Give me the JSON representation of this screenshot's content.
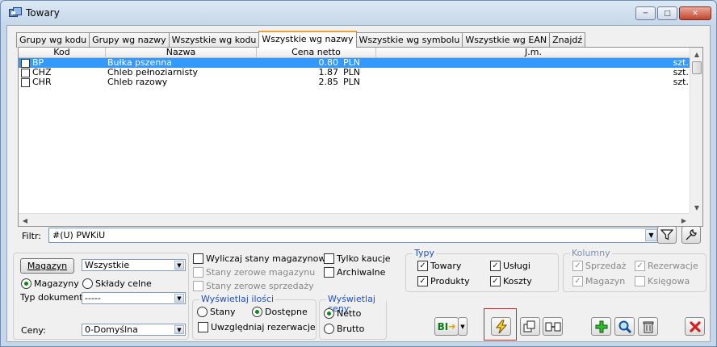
{
  "window": {
    "title": "Towary"
  },
  "tabs": [
    {
      "label": "Grupy wg kodu"
    },
    {
      "label": "Grupy wg nazwy"
    },
    {
      "label": "Wszystkie wg kodu"
    },
    {
      "label": "Wszystkie wg nazwy",
      "active": true
    },
    {
      "label": "Wszystkie wg symbolu"
    },
    {
      "label": "Wszystkie wg EAN"
    },
    {
      "label": "Znajdź"
    }
  ],
  "grid": {
    "columns": [
      "Kod",
      "Nazwa",
      "Cena netto",
      "J.m."
    ],
    "rows": [
      {
        "kod": "BP",
        "nazwa": "Bułka pszenna",
        "cena": "0.80",
        "waluta": "PLN",
        "jm": "szt."
      },
      {
        "kod": "CHZ",
        "nazwa": "Chleb pełnoziarnisty",
        "cena": "1.87",
        "waluta": "PLN",
        "jm": "szt."
      },
      {
        "kod": "CHR",
        "nazwa": "Chleb razowy",
        "cena": "2.85",
        "waluta": "PLN",
        "jm": "szt."
      }
    ]
  },
  "filter": {
    "label": "Filtr:",
    "value": "#(U) PWKiU"
  },
  "left": {
    "magazyn_button": "Magazyn",
    "magazyn_value": "Wszystkie",
    "radio_magazyny": "Magazyny",
    "radio_sklady": "Składy celne",
    "typ_dokumentu_label": "Typ dokumentu:",
    "typ_dokumentu_value": "-----",
    "ceny_label": "Ceny:",
    "ceny_value": "0-Domyślna"
  },
  "stany": {
    "wyliczaj": "Wyliczaj stany magazynowe",
    "zerowe_mag": "Stany zerowe magazynu",
    "zerowe_sprz": "Stany zerowe sprzedaży",
    "tylko_kaucje": "Tylko kaucje",
    "archiwalne": "Archiwalne"
  },
  "ilosci": {
    "title": "Wyświetlaj ilości",
    "stany": "Stany",
    "dostepne": "Dostępne",
    "rezerwacje": "Uwzględniaj rezerwacje"
  },
  "ceny_panel": {
    "title": "Wyświetlaj ceny:",
    "netto": "Netto",
    "brutto": "Brutto"
  },
  "typy": {
    "title": "Typy",
    "towary": "Towary",
    "uslugi": "Usługi",
    "produkty": "Produkty",
    "koszty": "Koszty"
  },
  "kolumny": {
    "title": "Kolumny",
    "sprzedaz": "Sprzedaż",
    "rezerwacje": "Rezerwacje",
    "magazyn": "Magazyn",
    "ksiegowa": "Księgowa"
  },
  "icons": {
    "bi_label": "BI"
  },
  "colors": {
    "selection": "#3399ff",
    "accent_red": "#d42020",
    "panel_title": "#1f4fbf"
  }
}
